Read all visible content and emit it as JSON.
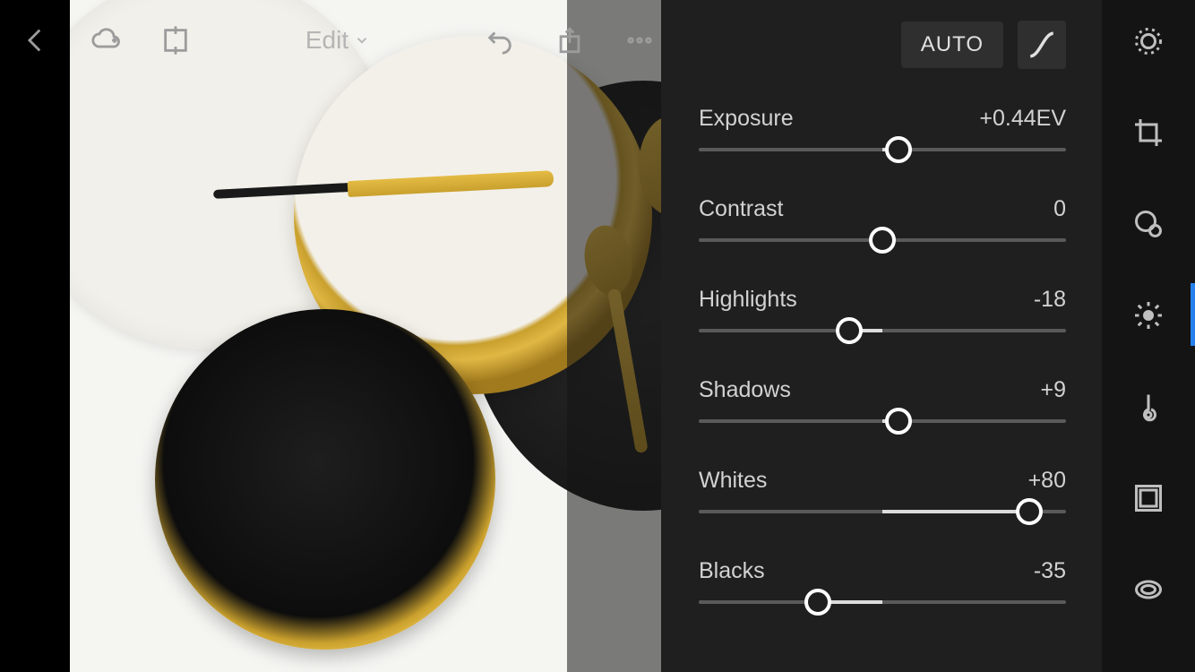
{
  "header": {
    "edit_label": "Edit"
  },
  "panel": {
    "auto_label": "AUTO"
  },
  "sliders": [
    {
      "label": "Exposure",
      "value_text": "+0.44EV",
      "percent": 54.4
    },
    {
      "label": "Contrast",
      "value_text": "0",
      "percent": 50
    },
    {
      "label": "Highlights",
      "value_text": "-18",
      "percent": 41
    },
    {
      "label": "Shadows",
      "value_text": "+9",
      "percent": 54.5
    },
    {
      "label": "Whites",
      "value_text": "+80",
      "percent": 90
    },
    {
      "label": "Blacks",
      "value_text": "-35",
      "percent": 32.5
    }
  ],
  "tools": {
    "loupe": "loupe",
    "crop": "crop",
    "heal": "healing-brush",
    "light": "light-panel",
    "temp": "temperature",
    "vignette": "vignette",
    "lens": "lens-correction"
  }
}
